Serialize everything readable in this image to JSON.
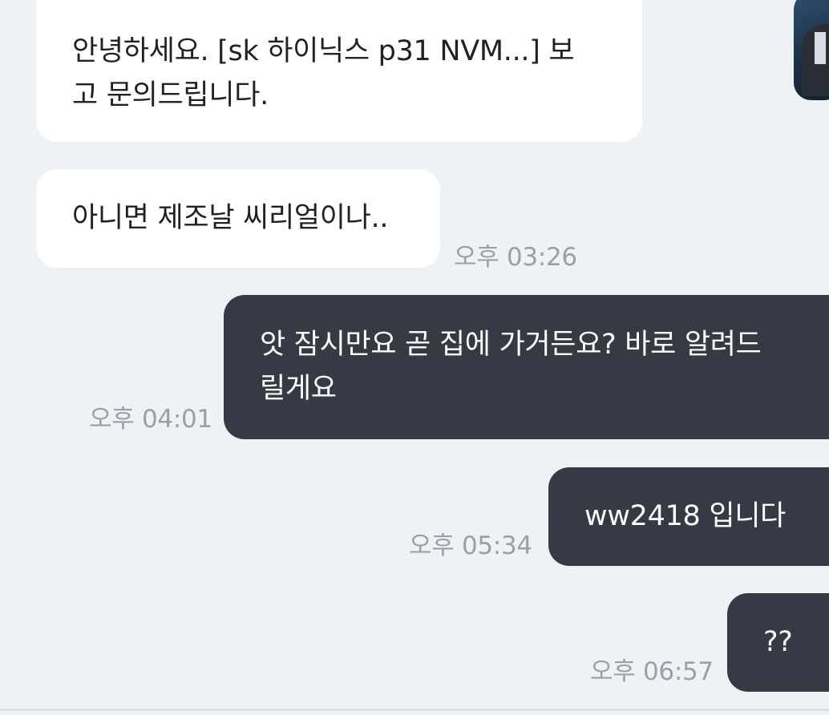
{
  "messages": [
    {
      "direction": "incoming",
      "text": "안녕하세요. [sk 하이닉스 p31 NVM...] 보\n고 문의드립니다.",
      "time": ""
    },
    {
      "direction": "incoming",
      "text": "아니면 제조날 씨리얼이나..",
      "time": "오후 03:26"
    },
    {
      "direction": "outgoing",
      "text": "앗 잠시만요 곧 집에 가거든요? 바로 알려드\n릴게요",
      "time": "오후 04:01"
    },
    {
      "direction": "outgoing",
      "text": "ww2418 입니다",
      "time": "오후 05:34"
    },
    {
      "direction": "outgoing",
      "text": "??",
      "time": "오후 06:57"
    }
  ],
  "colors": {
    "background": "#eff2f5",
    "incoming_bubble": "#ffffff",
    "outgoing_bubble": "#363a44",
    "timestamp": "#9aa0aa"
  },
  "thumbnail": {
    "icon": "video-thumbnail-icon"
  }
}
